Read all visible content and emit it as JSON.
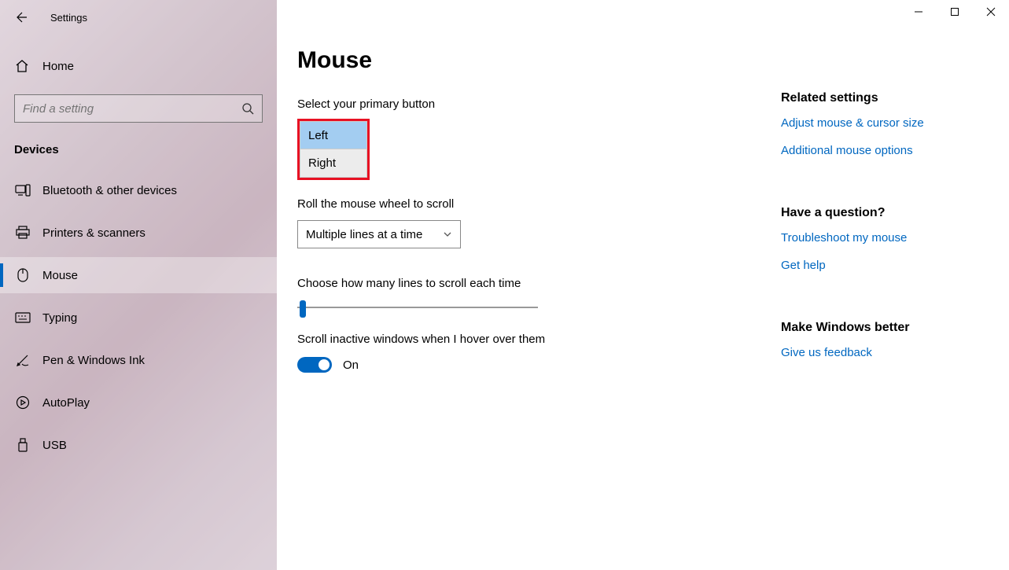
{
  "header": {
    "title": "Settings"
  },
  "sidebar": {
    "home": "Home",
    "search_placeholder": "Find a setting",
    "section": "Devices",
    "items": [
      {
        "label": "Bluetooth & other devices"
      },
      {
        "label": "Printers & scanners"
      },
      {
        "label": "Mouse"
      },
      {
        "label": "Typing"
      },
      {
        "label": "Pen & Windows Ink"
      },
      {
        "label": "AutoPlay"
      },
      {
        "label": "USB"
      }
    ]
  },
  "main": {
    "title": "Mouse",
    "primary_label": "Select your primary button",
    "primary_options": {
      "left": "Left",
      "right": "Right"
    },
    "roll_label": "Roll the mouse wheel to scroll",
    "wheel_value": "Multiple lines at a time",
    "lines_label": "Choose how many lines to scroll each time",
    "hover_label": "Scroll inactive windows when I hover over them",
    "toggle_state": "On"
  },
  "right": {
    "related_heading": "Related settings",
    "link_adjust": "Adjust mouse & cursor size",
    "link_additional": "Additional mouse options",
    "question_heading": "Have a question?",
    "link_troubleshoot": "Troubleshoot my mouse",
    "link_help": "Get help",
    "better_heading": "Make Windows better",
    "link_feedback": "Give us feedback"
  }
}
